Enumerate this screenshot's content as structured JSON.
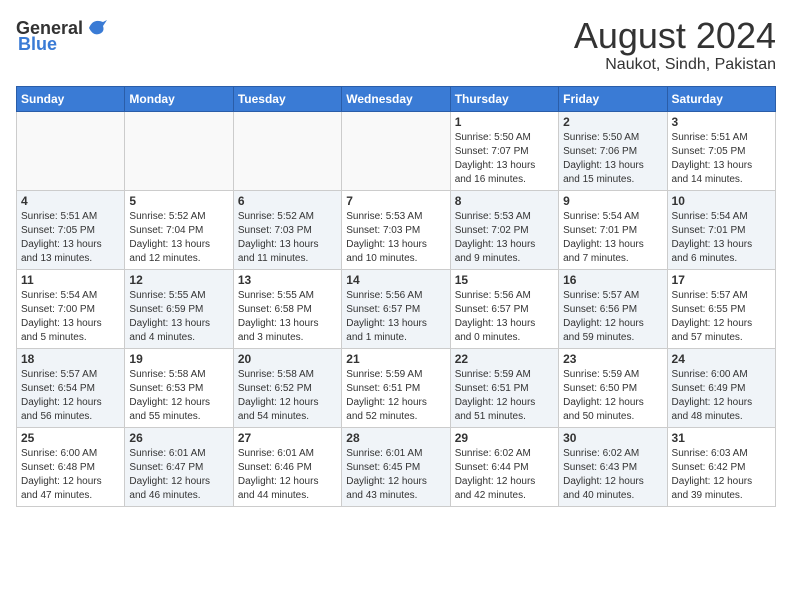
{
  "logo": {
    "general": "General",
    "blue": "Blue"
  },
  "title": {
    "month_year": "August 2024",
    "location": "Naukot, Sindh, Pakistan"
  },
  "weekdays": [
    "Sunday",
    "Monday",
    "Tuesday",
    "Wednesday",
    "Thursday",
    "Friday",
    "Saturday"
  ],
  "weeks": [
    [
      {
        "day": "",
        "info": "",
        "empty": true
      },
      {
        "day": "",
        "info": "",
        "empty": true
      },
      {
        "day": "",
        "info": "",
        "empty": true
      },
      {
        "day": "",
        "info": "",
        "empty": true
      },
      {
        "day": "1",
        "info": "Sunrise: 5:50 AM\nSunset: 7:07 PM\nDaylight: 13 hours\nand 16 minutes.",
        "shaded": false
      },
      {
        "day": "2",
        "info": "Sunrise: 5:50 AM\nSunset: 7:06 PM\nDaylight: 13 hours\nand 15 minutes.",
        "shaded": true
      },
      {
        "day": "3",
        "info": "Sunrise: 5:51 AM\nSunset: 7:05 PM\nDaylight: 13 hours\nand 14 minutes.",
        "shaded": false
      }
    ],
    [
      {
        "day": "4",
        "info": "Sunrise: 5:51 AM\nSunset: 7:05 PM\nDaylight: 13 hours\nand 13 minutes.",
        "shaded": true
      },
      {
        "day": "5",
        "info": "Sunrise: 5:52 AM\nSunset: 7:04 PM\nDaylight: 13 hours\nand 12 minutes.",
        "shaded": false
      },
      {
        "day": "6",
        "info": "Sunrise: 5:52 AM\nSunset: 7:03 PM\nDaylight: 13 hours\nand 11 minutes.",
        "shaded": true
      },
      {
        "day": "7",
        "info": "Sunrise: 5:53 AM\nSunset: 7:03 PM\nDaylight: 13 hours\nand 10 minutes.",
        "shaded": false
      },
      {
        "day": "8",
        "info": "Sunrise: 5:53 AM\nSunset: 7:02 PM\nDaylight: 13 hours\nand 9 minutes.",
        "shaded": true
      },
      {
        "day": "9",
        "info": "Sunrise: 5:54 AM\nSunset: 7:01 PM\nDaylight: 13 hours\nand 7 minutes.",
        "shaded": false
      },
      {
        "day": "10",
        "info": "Sunrise: 5:54 AM\nSunset: 7:01 PM\nDaylight: 13 hours\nand 6 minutes.",
        "shaded": true
      }
    ],
    [
      {
        "day": "11",
        "info": "Sunrise: 5:54 AM\nSunset: 7:00 PM\nDaylight: 13 hours\nand 5 minutes.",
        "shaded": false
      },
      {
        "day": "12",
        "info": "Sunrise: 5:55 AM\nSunset: 6:59 PM\nDaylight: 13 hours\nand 4 minutes.",
        "shaded": true
      },
      {
        "day": "13",
        "info": "Sunrise: 5:55 AM\nSunset: 6:58 PM\nDaylight: 13 hours\nand 3 minutes.",
        "shaded": false
      },
      {
        "day": "14",
        "info": "Sunrise: 5:56 AM\nSunset: 6:57 PM\nDaylight: 13 hours\nand 1 minute.",
        "shaded": true
      },
      {
        "day": "15",
        "info": "Sunrise: 5:56 AM\nSunset: 6:57 PM\nDaylight: 13 hours\nand 0 minutes.",
        "shaded": false
      },
      {
        "day": "16",
        "info": "Sunrise: 5:57 AM\nSunset: 6:56 PM\nDaylight: 12 hours\nand 59 minutes.",
        "shaded": true
      },
      {
        "day": "17",
        "info": "Sunrise: 5:57 AM\nSunset: 6:55 PM\nDaylight: 12 hours\nand 57 minutes.",
        "shaded": false
      }
    ],
    [
      {
        "day": "18",
        "info": "Sunrise: 5:57 AM\nSunset: 6:54 PM\nDaylight: 12 hours\nand 56 minutes.",
        "shaded": true
      },
      {
        "day": "19",
        "info": "Sunrise: 5:58 AM\nSunset: 6:53 PM\nDaylight: 12 hours\nand 55 minutes.",
        "shaded": false
      },
      {
        "day": "20",
        "info": "Sunrise: 5:58 AM\nSunset: 6:52 PM\nDaylight: 12 hours\nand 54 minutes.",
        "shaded": true
      },
      {
        "day": "21",
        "info": "Sunrise: 5:59 AM\nSunset: 6:51 PM\nDaylight: 12 hours\nand 52 minutes.",
        "shaded": false
      },
      {
        "day": "22",
        "info": "Sunrise: 5:59 AM\nSunset: 6:51 PM\nDaylight: 12 hours\nand 51 minutes.",
        "shaded": true
      },
      {
        "day": "23",
        "info": "Sunrise: 5:59 AM\nSunset: 6:50 PM\nDaylight: 12 hours\nand 50 minutes.",
        "shaded": false
      },
      {
        "day": "24",
        "info": "Sunrise: 6:00 AM\nSunset: 6:49 PM\nDaylight: 12 hours\nand 48 minutes.",
        "shaded": true
      }
    ],
    [
      {
        "day": "25",
        "info": "Sunrise: 6:00 AM\nSunset: 6:48 PM\nDaylight: 12 hours\nand 47 minutes.",
        "shaded": false
      },
      {
        "day": "26",
        "info": "Sunrise: 6:01 AM\nSunset: 6:47 PM\nDaylight: 12 hours\nand 46 minutes.",
        "shaded": true
      },
      {
        "day": "27",
        "info": "Sunrise: 6:01 AM\nSunset: 6:46 PM\nDaylight: 12 hours\nand 44 minutes.",
        "shaded": false
      },
      {
        "day": "28",
        "info": "Sunrise: 6:01 AM\nSunset: 6:45 PM\nDaylight: 12 hours\nand 43 minutes.",
        "shaded": true
      },
      {
        "day": "29",
        "info": "Sunrise: 6:02 AM\nSunset: 6:44 PM\nDaylight: 12 hours\nand 42 minutes.",
        "shaded": false
      },
      {
        "day": "30",
        "info": "Sunrise: 6:02 AM\nSunset: 6:43 PM\nDaylight: 12 hours\nand 40 minutes.",
        "shaded": true
      },
      {
        "day": "31",
        "info": "Sunrise: 6:03 AM\nSunset: 6:42 PM\nDaylight: 12 hours\nand 39 minutes.",
        "shaded": false
      }
    ]
  ]
}
